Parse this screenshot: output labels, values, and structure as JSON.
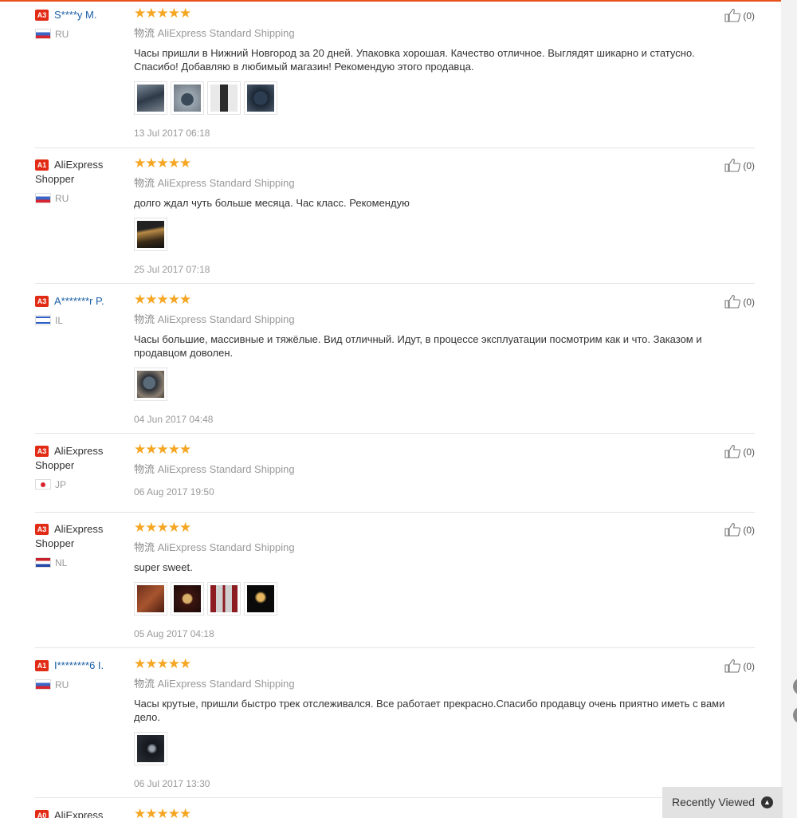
{
  "accent": "#e8501c",
  "star_color": "#f5a623",
  "icons": {
    "thumbs_up": "thumbs-up-icon",
    "chevron_up": "chevron-up-icon"
  },
  "reviews": [
    {
      "level": "A3",
      "name": "S****y M.",
      "name_is_link": true,
      "country": "RU",
      "stars": "★★★★★",
      "ship_cn": "物流",
      "ship": "AliExpress Standard Shipping",
      "comment": "Часы пришли в Нижний Новгород за 20 дней. Упаковка хорошая. Качество отличное. Выглядят шикарно и статусно. Спасибо! Добавляю в любимый магазин! Рекомендую этого продавца.",
      "photos": 4,
      "date": "13 Jul 2017 06:18",
      "helpful": "(0)"
    },
    {
      "level": "A1",
      "name": "AliExpress Shopper",
      "name_is_link": false,
      "country": "RU",
      "stars": "★★★★★",
      "ship_cn": "物流",
      "ship": "AliExpress Standard Shipping",
      "comment": "долго ждал чуть больше месяца. Час класс. Рекомендую",
      "photos": 1,
      "date": "25 Jul 2017 07:18",
      "helpful": "(0)"
    },
    {
      "level": "A3",
      "name": "A*******r P.",
      "name_is_link": true,
      "country": "IL",
      "stars": "★★★★★",
      "ship_cn": "物流",
      "ship": "AliExpress Standard Shipping",
      "comment": "Часы большие, массивные и тяжёлые. Вид отличный. Идут, в процессе эксплуатации посмотрим как и что. Заказом и продавцом доволен.",
      "photos": 1,
      "date": "04 Jun 2017 04:48",
      "helpful": "(0)"
    },
    {
      "level": "A3",
      "name": "AliExpress Shopper",
      "name_is_link": false,
      "country": "JP",
      "stars": "★★★★★",
      "ship_cn": "物流",
      "ship": "AliExpress Standard Shipping",
      "comment": "",
      "photos": 0,
      "date": "06 Aug 2017 19:50",
      "helpful": "(0)"
    },
    {
      "level": "A3",
      "name": "AliExpress Shopper",
      "name_is_link": false,
      "country": "NL",
      "stars": "★★★★★",
      "ship_cn": "物流",
      "ship": "AliExpress Standard Shipping",
      "comment": "super sweet.",
      "photos": 4,
      "date": "05 Aug 2017 04:18",
      "helpful": "(0)"
    },
    {
      "level": "A1",
      "name": "I********6 I.",
      "name_is_link": true,
      "country": "RU",
      "stars": "★★★★★",
      "ship_cn": "物流",
      "ship": "AliExpress Standard Shipping",
      "comment": "Часы крутые, пришли быстро трек отслеживался. Все работает прекрасно.Спасибо продавцу очень приятно иметь с вами дело.",
      "photos": 1,
      "date": "06 Jul 2017 13:30",
      "helpful": "(0)"
    },
    {
      "level": "A0",
      "name": "AliExpress",
      "name_is_link": false,
      "country": "",
      "stars": "★★★★★"
    }
  ],
  "recently_viewed": "Recently Viewed"
}
